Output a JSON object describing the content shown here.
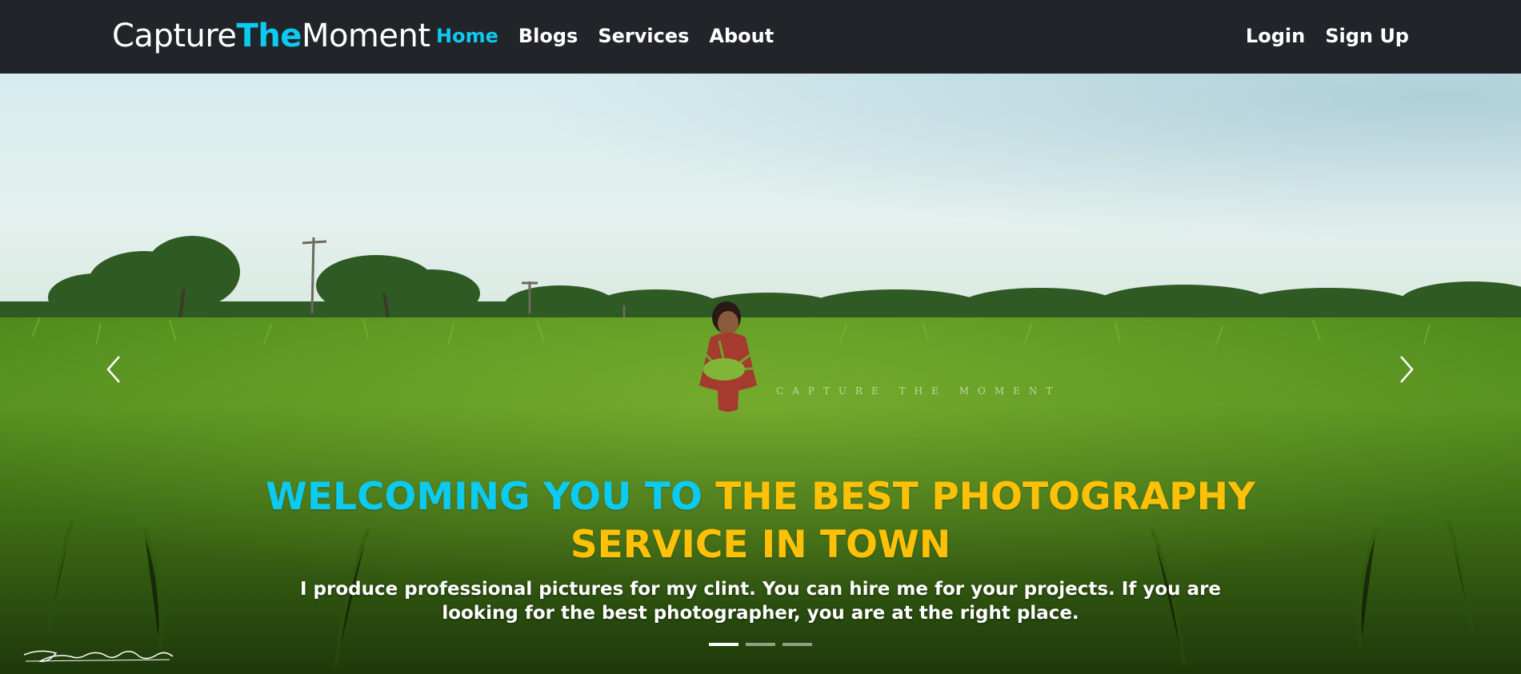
{
  "brand": {
    "part1": "Capture",
    "part2": "The",
    "part3": "Moment"
  },
  "nav": {
    "items": [
      {
        "label": "Home",
        "active": true
      },
      {
        "label": "Blogs",
        "active": false
      },
      {
        "label": "Services",
        "active": false
      },
      {
        "label": "About",
        "active": false
      }
    ],
    "right": [
      {
        "label": "Login"
      },
      {
        "label": "Sign Up"
      }
    ]
  },
  "hero": {
    "watermark": "CAPTURE THE MOMENT",
    "headline_accent": "WELCOMING YOU TO",
    "headline_main": "THE BEST PHOTOGRAPHY SERVICE IN TOWN",
    "description": "I produce professional pictures for my clint. You can hire me for your projects. If you are looking for the best photographer, you are at the right place.",
    "indicators": [
      {
        "active": true
      },
      {
        "active": false
      },
      {
        "active": false
      }
    ],
    "prev_icon": "chevron-left-icon",
    "next_icon": "chevron-right-icon"
  },
  "colors": {
    "navbar_bg": "#212529",
    "accent_cyan": "#0dcaf0",
    "accent_yellow": "#ffc107"
  }
}
